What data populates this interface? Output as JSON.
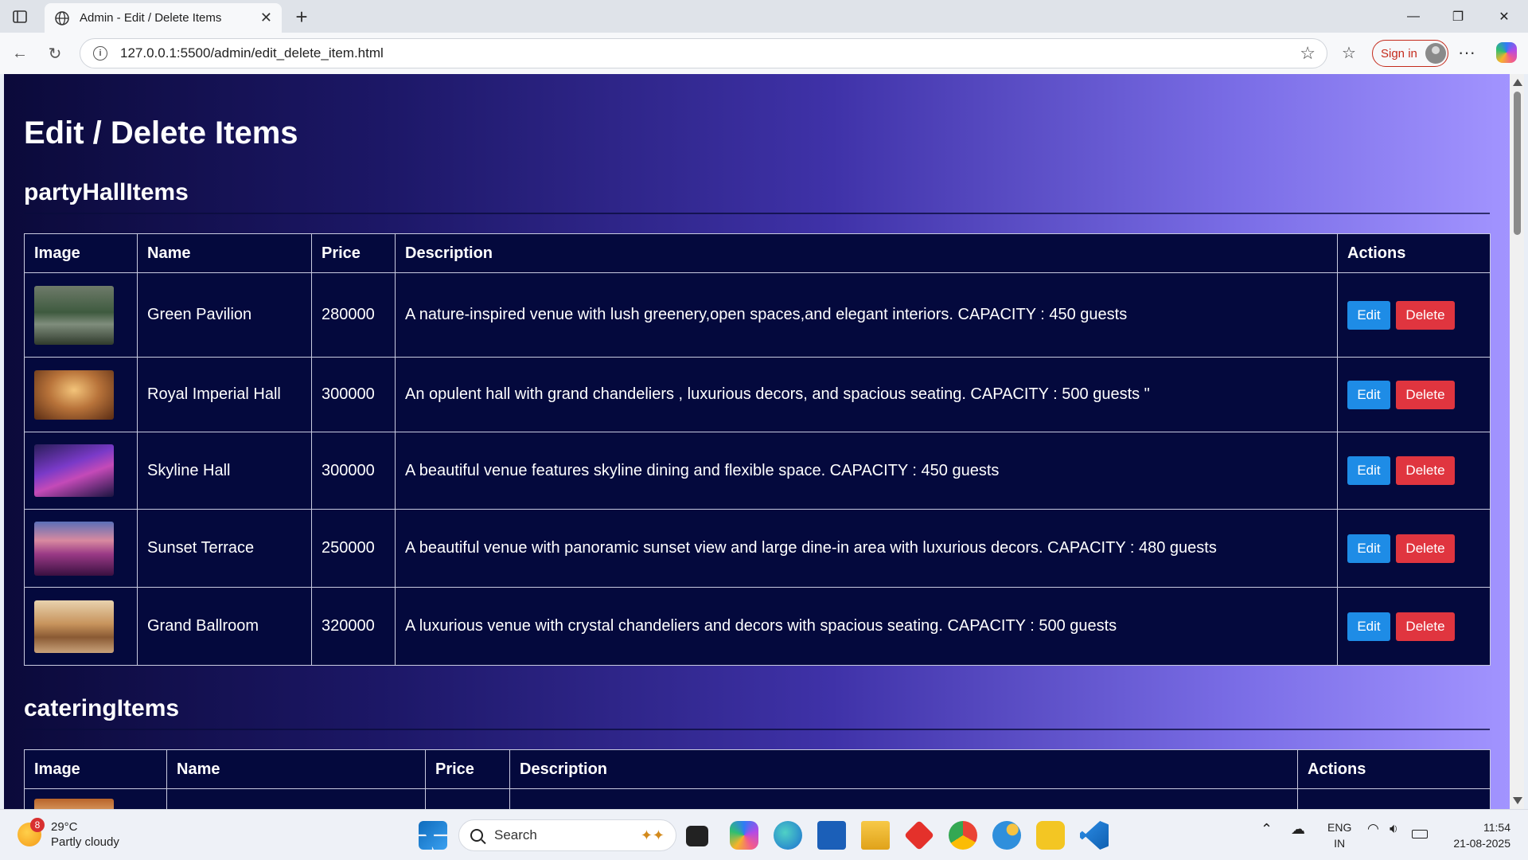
{
  "browser": {
    "tab_title": "Admin - Edit / Delete Items",
    "tab_close": "✕",
    "new_tab": "+",
    "url": "127.0.0.1:5500/admin/edit_delete_item.html",
    "sign_in": "Sign in",
    "more": "···",
    "win_min": "—",
    "win_max": "❐",
    "win_close": "✕"
  },
  "page": {
    "heading": "Edit / Delete Items",
    "sections": [
      {
        "title": "partyHallItems",
        "columns": [
          "Image",
          "Name",
          "Price",
          "Description",
          "Actions"
        ],
        "rows": [
          {
            "name": "Green Pavilion",
            "price": "280000",
            "description": "A nature-inspired venue with lush greenery,open spaces,and elegant interiors. CAPACITY : 450 guests"
          },
          {
            "name": "Royal Imperial Hall",
            "price": "300000",
            "description": "An opulent hall with grand chandeliers , luxurious decors, and spacious seating. CAPACITY : 500 guests \""
          },
          {
            "name": "Skyline Hall",
            "price": "300000",
            "description": "A beautiful venue features skyline dining and flexible space. CAPACITY : 450 guests"
          },
          {
            "name": "Sunset Terrace",
            "price": "250000",
            "description": "A beautiful venue with panoramic sunset view and large dine-in area with luxurious decors. CAPACITY : 480 guests"
          },
          {
            "name": "Grand Ballroom",
            "price": "320000",
            "description": "A luxurious venue with crystal chandeliers and decors with spacious seating. CAPACITY : 500 guests"
          }
        ],
        "edit_label": "Edit",
        "delete_label": "Delete"
      },
      {
        "title": "cateringItems",
        "columns": [
          "Image",
          "Name",
          "Price",
          "Description",
          "Actions"
        ]
      }
    ]
  },
  "taskbar": {
    "weather_badge": "8",
    "temperature": "29°C",
    "weather_desc": "Partly cloudy",
    "search_label": "Search",
    "lang_top": "ENG",
    "lang_bottom": "IN",
    "time": "11:54",
    "date": "21-08-2025"
  },
  "colors": {
    "table_bg": "#04093d",
    "edit_button": "#1e8ce6",
    "delete_button": "#e0353f",
    "signin_accent": "#c42b1c"
  }
}
